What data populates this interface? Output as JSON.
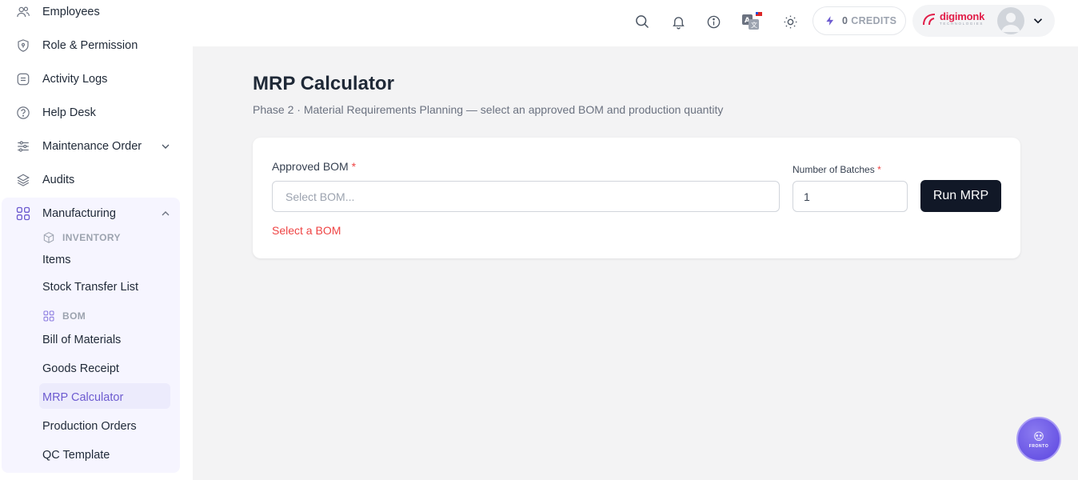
{
  "sidebar": {
    "items": [
      {
        "label": "Employees",
        "icon": "users-icon"
      },
      {
        "label": "Role & Permission",
        "icon": "shield-icon"
      },
      {
        "label": "Activity Logs",
        "icon": "log-icon"
      },
      {
        "label": "Help Desk",
        "icon": "help-icon"
      },
      {
        "label": "Maintenance Order",
        "icon": "sliders-icon"
      },
      {
        "label": "Audits",
        "icon": "layers-icon"
      },
      {
        "label": "Manufacturing",
        "icon": "grid-icon"
      }
    ],
    "manufacturing": {
      "section_inventory": "INVENTORY",
      "inventory_items": [
        "Items",
        "Stock Transfer List"
      ],
      "section_bom": "BOM",
      "bom_items": [
        "Bill of Materials",
        "Goods Receipt",
        "MRP Calculator",
        "Production Orders",
        "QC Template"
      ],
      "active": "MRP Calculator"
    }
  },
  "header": {
    "credits_count": "0",
    "credits_label": "CREDITS",
    "brand_name": "digimonk",
    "brand_sub": "TECHNOLOGIES"
  },
  "main": {
    "title": "MRP Calculator",
    "subtitle": "Phase 2 · Material Requirements Planning — select an approved BOM and production quantity",
    "bom_label": "Approved BOM",
    "bom_placeholder": "Select BOM...",
    "bom_error": "Select a BOM",
    "batches_label": "Number of Batches",
    "batches_value": "1",
    "required_mark": "*",
    "run_button": "Run MRP"
  },
  "fab": {
    "label": "FRONTO"
  },
  "colors": {
    "accent": "#6d5bd0",
    "error": "#ef4444",
    "button": "#111827"
  }
}
